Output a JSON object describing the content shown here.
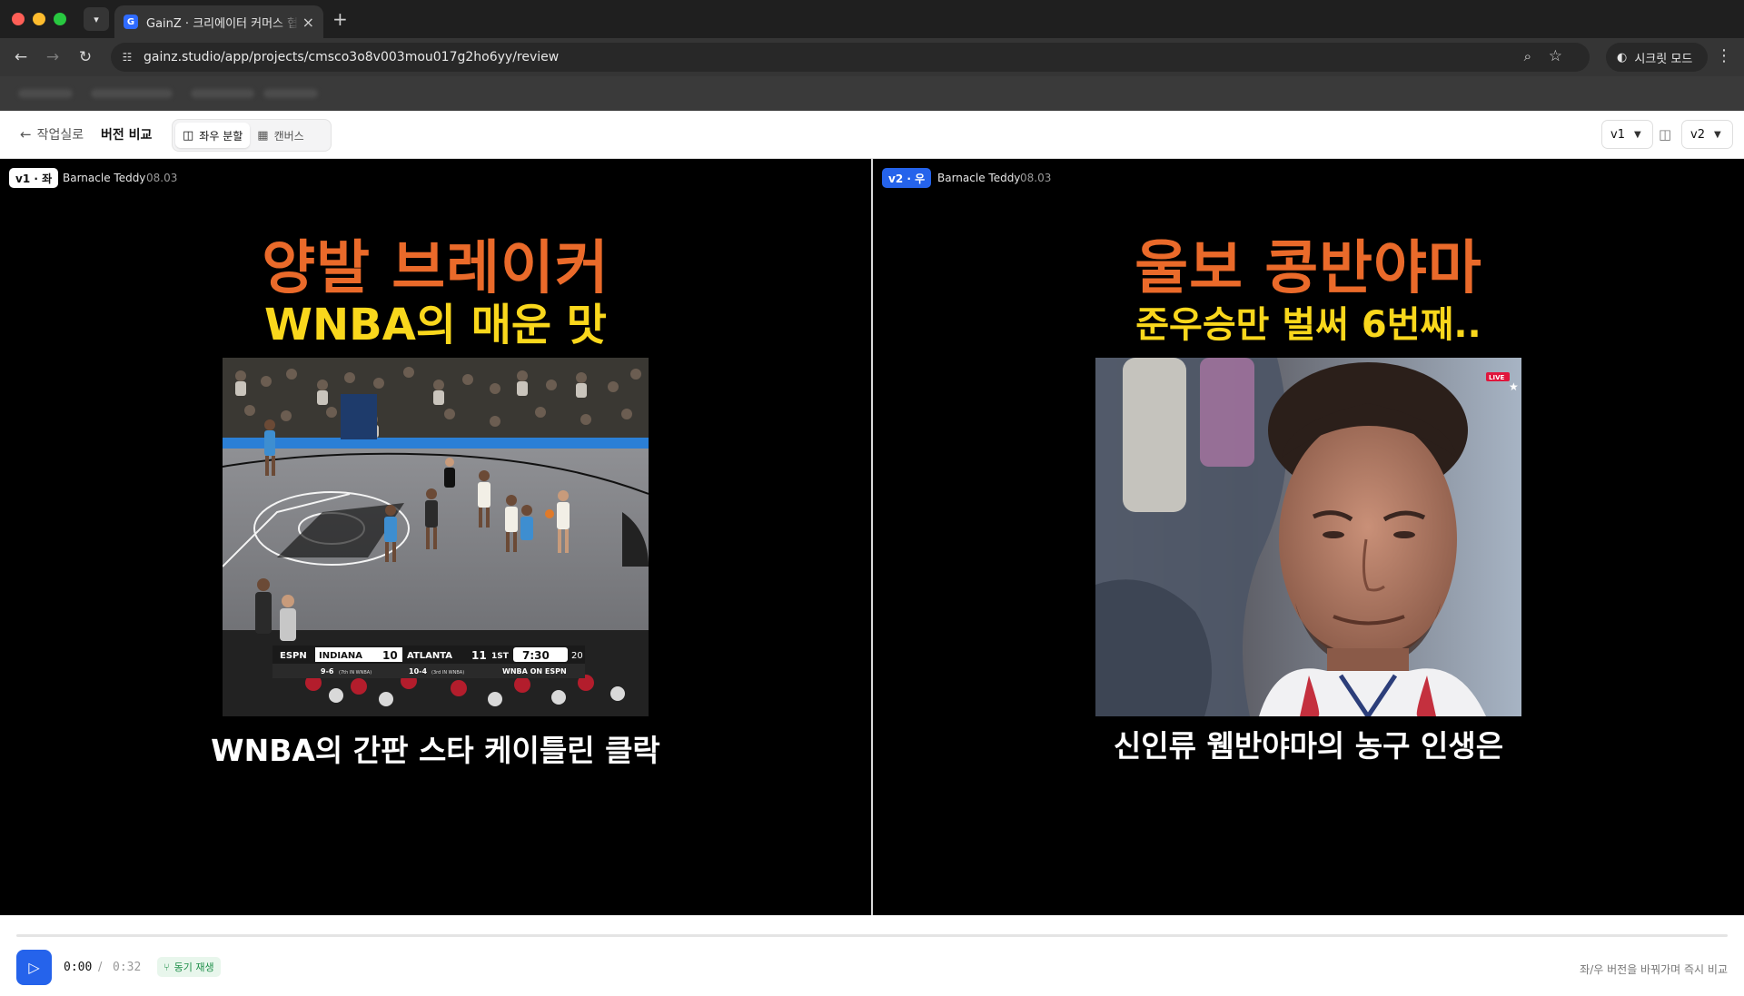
{
  "browser": {
    "tab_title": "GainZ · 크리에이터 커머스 협업 C",
    "favicon_letter": "G",
    "url": "gainz.studio/app/projects/cmsco3o8v003mou017g2ho6yy/review",
    "incognito_label": "시크릿 모드",
    "icons": {
      "tab_list": "chevron-down-icon",
      "tab_close": "close-icon",
      "new_tab": "plus-icon",
      "back": "arrow-left-icon",
      "forward": "arrow-right-icon",
      "reload": "reload-icon",
      "site_info": "tune-icon",
      "zoom": "magnifier-icon",
      "bookmark": "star-icon",
      "incognito": "incognito-icon",
      "menu": "kebab-menu-icon"
    }
  },
  "header": {
    "back_label": "작업실로",
    "title": "버전 비교",
    "view_modes": [
      {
        "label": "좌우 분할",
        "icon": "split-columns-icon",
        "active": true
      },
      {
        "label": "캔버스",
        "icon": "grid-icon",
        "active": false
      }
    ],
    "left_version": "v1",
    "right_version": "v2",
    "swap_icon": "columns-swap-icon"
  },
  "panes": {
    "left": {
      "badge": "v1 · 좌",
      "author": "Barnacle Teddy",
      "date": "08.03",
      "title_line1": "양발 브레이커",
      "title_line2": "WNBA의 매운 맛",
      "caption": "WNBA의 간판 스타 케이틀린 클락",
      "scoreboard": {
        "network": "ESPN",
        "home_team": "INDIANA",
        "home_score": "10",
        "away_team": "ATLANTA",
        "away_score": "11",
        "period": "1ST",
        "clock": "7:30",
        "shot_clock": "20",
        "home_record": "9-6",
        "home_standing": "(7th IN WNBA)",
        "away_record": "10-4",
        "away_standing": "(3rd IN WNBA)",
        "broadcast": "WNBA ON ESPN"
      }
    },
    "right": {
      "badge": "v2 · 우",
      "author": "Barnacle Teddy",
      "date": "08.03",
      "title_line1": "울보 콩반야마",
      "title_line2": "준우승만 벌써 6번째..",
      "caption": "신인류 웸반야마의 농구 인생은",
      "live_tag": "LIVE"
    }
  },
  "transport": {
    "play_icon": "play-icon",
    "current_time": "0:00",
    "separator": "/",
    "total_time": "0:32",
    "progress": 0.0,
    "sync_label": "동기 재생",
    "sync_icon": "sync-branch-icon",
    "hint": "좌/우 버전을 바꿔가며 즉시 비교"
  },
  "colors": {
    "accent": "#2563eb",
    "title_orange": "#ea6a2a",
    "title_yellow": "#f9d71c",
    "sync_green": "#1f8f4a"
  }
}
